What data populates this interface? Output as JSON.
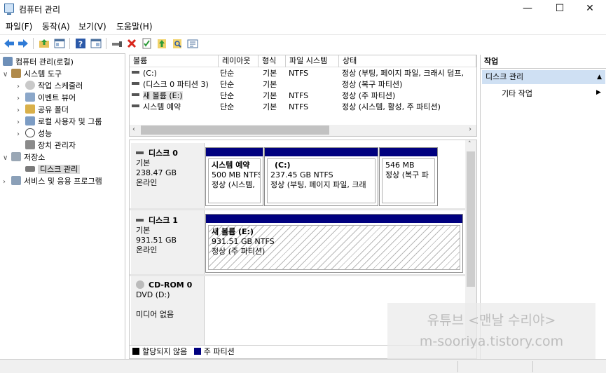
{
  "window": {
    "title": "컴퓨터 관리",
    "controls": {
      "minimize": "—",
      "maximize": "☐",
      "close": "✕"
    }
  },
  "menu": [
    "파일(F)",
    "동작(A)",
    "보기(V)",
    "도움말(H)"
  ],
  "tree": {
    "root": "컴퓨터 관리(로컬)",
    "system_tools": "시스템 도구",
    "task_scheduler": "작업 스케줄러",
    "event_viewer": "이벤트 뷰어",
    "shared_folders": "공유 폴더",
    "local_users": "로컬 사용자 및 그룹",
    "performance": "성능",
    "device_manager": "장치 관리자",
    "storage": "저장소",
    "disk_management": "디스크 관리",
    "services": "서비스 및 응용 프로그램"
  },
  "volume_list": {
    "columns": [
      "볼륨",
      "레이아웃",
      "형식",
      "파일 시스템",
      "상태"
    ],
    "rows": [
      {
        "name": "(C:)",
        "layout": "단순",
        "type": "기본",
        "fs": "NTFS",
        "status": "정상 (부팅, 페이지 파일, 크래시 덤프,"
      },
      {
        "name": "(디스크 0 파티션 3)",
        "layout": "단순",
        "type": "기본",
        "fs": "",
        "status": "정상 (복구 파티션)"
      },
      {
        "name": "새 볼륨 (E:)",
        "layout": "단순",
        "type": "기본",
        "fs": "NTFS",
        "status": "정상 (주 파티션)"
      },
      {
        "name": "시스템 예약",
        "layout": "단순",
        "type": "기본",
        "fs": "NTFS",
        "status": "정상 (시스템, 활성, 주 파티션)"
      }
    ]
  },
  "disks": [
    {
      "name": "디스크 0",
      "type": "기본",
      "size": "238.47 GB",
      "state": "온라인",
      "partitions": [
        {
          "title": "시스템 예약",
          "size": "500 MB NTFS",
          "status": "정상 (시스템,"
        },
        {
          "title": "(C:)",
          "size": "237.45 GB NTFS",
          "status": "정상 (부팅, 페이지 파일, 크래"
        },
        {
          "title": "",
          "size": "546 MB",
          "status": "정상 (복구 파"
        }
      ]
    },
    {
      "name": "디스크 1",
      "type": "기본",
      "size": "931.51 GB",
      "state": "온라인",
      "partitions": [
        {
          "title": "새 볼륨 (E:)",
          "size": "931.51 GB NTFS",
          "status": "정상 (주 파티션)"
        }
      ]
    },
    {
      "name": "CD-ROM 0",
      "type": "DVD (D:)",
      "state": "미디어 없음"
    }
  ],
  "legend": {
    "unallocated": "할당되지 않음",
    "primary": "주 파티션",
    "unallocated_color": "#000000",
    "primary_color": "#00007f"
  },
  "actions": {
    "title": "작업",
    "section": "디스크 관리",
    "item": "기타 작업"
  },
  "watermark": {
    "line1": "유튜브 <맨날 수리야>",
    "line2": "m-sooriya.tistory.com"
  }
}
